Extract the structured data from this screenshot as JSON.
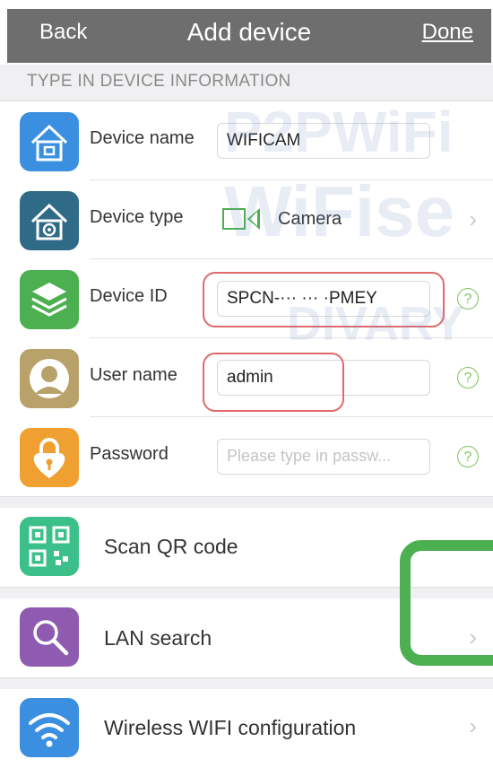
{
  "nav": {
    "back": "Back",
    "title": "Add device",
    "done": "Done"
  },
  "section": {
    "header": "TYPE IN DEVICE INFORMATION"
  },
  "fields": [
    {
      "label": "Device name",
      "value": "WIFICAM",
      "icon": "house-icon",
      "color": "#3a8fe0"
    },
    {
      "label": "Device type",
      "value": "Camera",
      "icon": "camera-house-icon",
      "color": "#2f6a86"
    },
    {
      "label": "Device ID",
      "value": "SPCN-··· ··· ·PMEY",
      "icon": "layers-icon",
      "color": "#4caf50"
    },
    {
      "label": "User name",
      "value": "admin",
      "icon": "user-icon",
      "color": "#b8a26a"
    },
    {
      "label": "Password",
      "placeholder": "Please type in passw...",
      "icon": "lock-icon",
      "color": "#f0a030"
    }
  ],
  "help_glyph": "?",
  "actions": [
    {
      "label": "Scan QR code",
      "icon": "qr-code-icon",
      "color": "#3cc08a"
    },
    {
      "label": "LAN search",
      "icon": "magnifier-icon",
      "color": "#8e5bb0"
    },
    {
      "label": "Wireless WIFI configuration",
      "icon": "wifi-icon",
      "color": "#3a8fe0"
    }
  ],
  "chevron": "›",
  "watermark": {
    "line1": "P2PWiFi",
    "line2": "WiFise",
    "line3": "DIVARY"
  }
}
